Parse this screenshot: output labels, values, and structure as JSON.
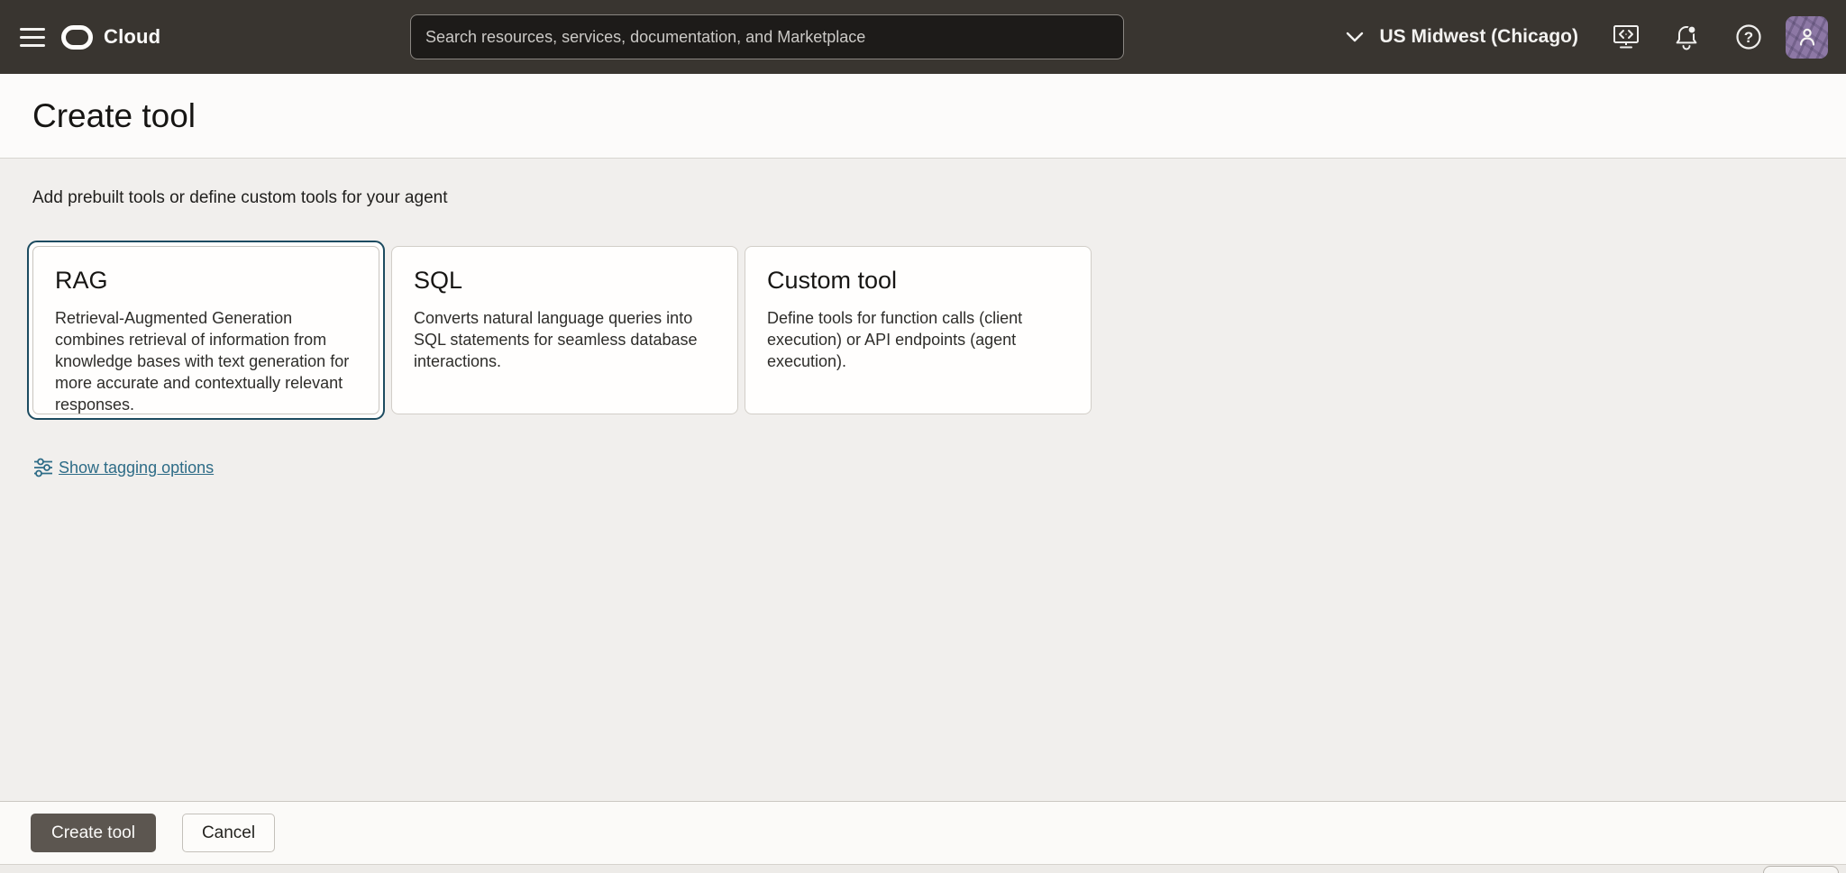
{
  "topbar": {
    "brand": "Cloud",
    "search": {
      "placeholder": "Search resources, services, documentation, and Marketplace",
      "value": ""
    },
    "region": {
      "label": "US Midwest (Chicago)"
    },
    "icons": [
      "hamburger-menu-icon",
      "oracle-cloud-logo-icon",
      "chevron-down-icon",
      "cloud-shell-icon",
      "notification-bell-icon",
      "help-icon",
      "user-avatar-icon"
    ]
  },
  "page": {
    "title": "Create tool",
    "subtitle": "Add prebuilt tools or define custom tools for your agent"
  },
  "cards": [
    {
      "title": "RAG",
      "description": "Retrieval-Augmented Generation combines retrieval of information from knowledge bases with text generation for more accurate and contextually relevant responses.",
      "selected": true
    },
    {
      "title": "SQL",
      "description": "Converts natural language queries into SQL statements for seamless database interactions.",
      "selected": false
    },
    {
      "title": "Custom tool",
      "description": "Define tools for function calls (client execution) or API endpoints (agent execution).",
      "selected": false
    }
  ],
  "tagging": {
    "label": "Show tagging options",
    "icon": "sliders-icon"
  },
  "footer": {
    "create_label": "Create tool",
    "cancel_label": "Cancel"
  },
  "colors": {
    "topbar_bg": "#393530",
    "selected_card_border": "#1c4b60",
    "link": "#2e6c87",
    "primary_button_bg": "#5c5650",
    "avatar_purple": "#8d78a5",
    "content_bg": "#f1efed"
  }
}
